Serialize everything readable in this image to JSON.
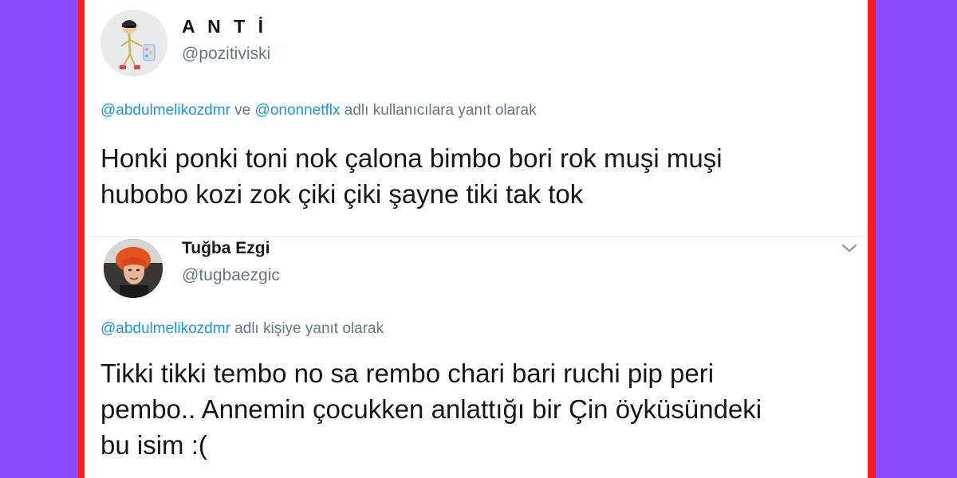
{
  "tweets": [
    {
      "display_name": "A N T İ",
      "handle": "@pozitiviski",
      "reply_mentions": [
        "@abdulmelikozdmr",
        "@ononnetflx"
      ],
      "reply_conjunction": " ve ",
      "reply_suffix": " adlı kullanıcılara yanıt olarak",
      "text_lines": [
        "Honki ponki toni nok çalona bimbo bori rok muşi muşi",
        "hubobo kozi zok çiki çiki şayne tiki tak tok"
      ]
    },
    {
      "display_name": "Tuğba Ezgi",
      "handle": "@tugbaezgic",
      "reply_mentions": [
        "@abdulmelikozdmr"
      ],
      "reply_suffix": " adlı kişiye yanıt olarak",
      "text_lines": [
        "Tikki tikki tembo no sa rembo chari bari ruchi pip peri",
        "pembo.. Annemin çocukken anlattığı bir Çin öyküsündeki",
        "bu isim :("
      ],
      "menu_icon": "chevron-down-icon"
    }
  ],
  "colors": {
    "background": "#8b4dff",
    "frame": "#ff1a1a",
    "mention": "#1b95e0",
    "secondary_text": "#657786",
    "primary_text": "#14171a"
  }
}
